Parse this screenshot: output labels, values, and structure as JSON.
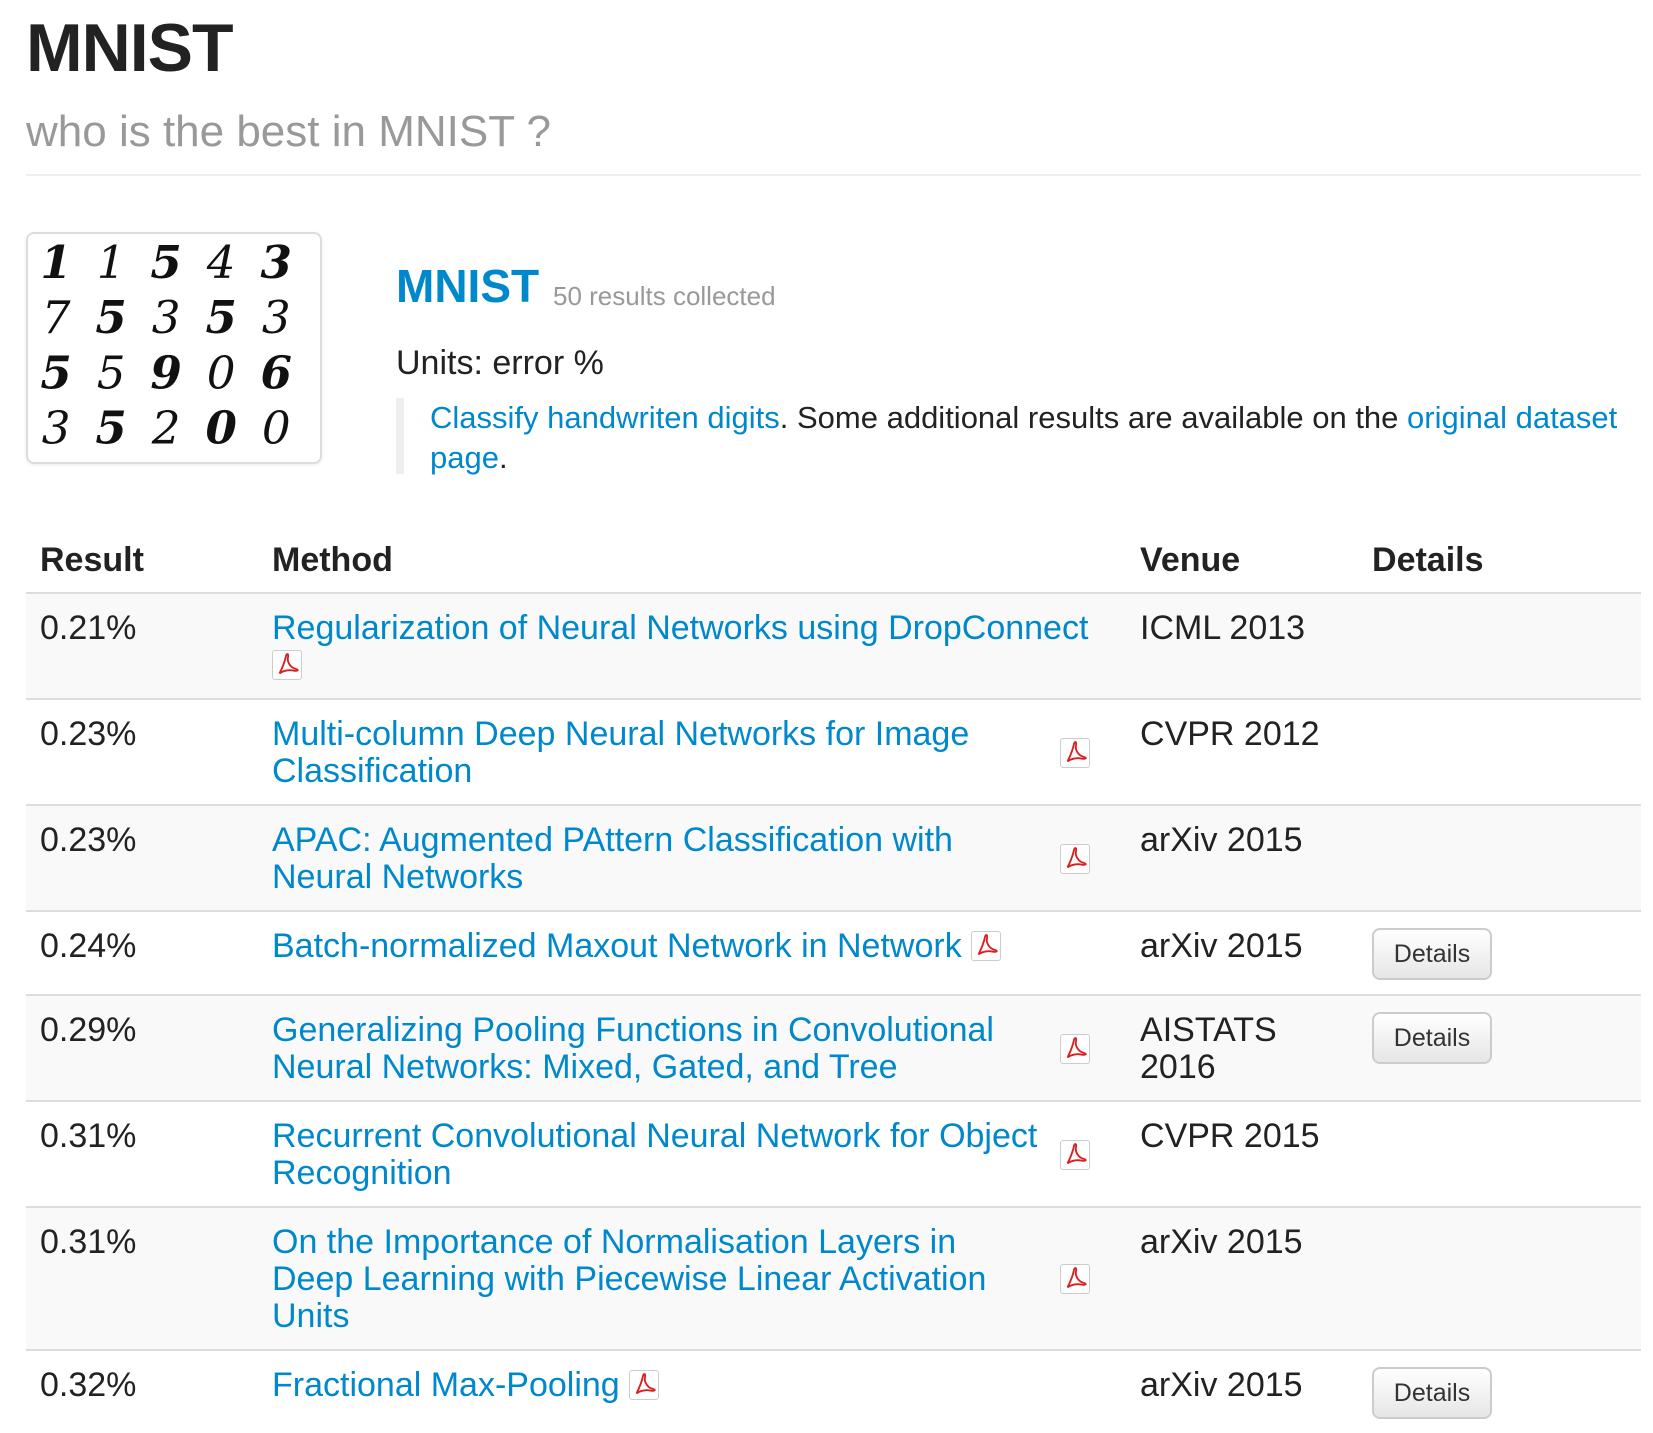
{
  "header": {
    "title": "MNIST",
    "subtitle": "who is the best in MNIST ?"
  },
  "dataset": {
    "name": "MNIST",
    "count_text": "50 results collected",
    "units": "Units: error %",
    "description": {
      "link1": "Classify handwriten digits",
      "text1": ". Some additional results are available on the ",
      "link2": "original dataset page",
      "text2": "."
    },
    "thumbnail_digits": [
      [
        "1",
        "1",
        "5",
        "4",
        "3"
      ],
      [
        "7",
        "5",
        "3",
        "5",
        "3"
      ],
      [
        "5",
        "5",
        "9",
        "0",
        "6"
      ],
      [
        "3",
        "5",
        "2",
        "0",
        "0"
      ]
    ]
  },
  "table": {
    "headers": {
      "result": "Result",
      "method": "Method",
      "venue": "Venue",
      "details": "Details"
    },
    "details_label": "Details",
    "pdf_icon": "pdf-icon",
    "rows": [
      {
        "result": "0.21%",
        "method": "Regularization of Neural Networks using DropConnect",
        "venue": "ICML 2013",
        "details": false
      },
      {
        "result": "0.23%",
        "method": "Multi-column Deep Neural Networks for Image Classification",
        "venue": "CVPR 2012",
        "details": false
      },
      {
        "result": "0.23%",
        "method": "APAC: Augmented PAttern Classification with Neural Networks",
        "venue": "arXiv 2015",
        "details": false
      },
      {
        "result": "0.24%",
        "method": "Batch-normalized Maxout Network in Network",
        "venue": "arXiv 2015",
        "details": true
      },
      {
        "result": "0.29%",
        "method": "Generalizing Pooling Functions in Convolutional Neural Networks: Mixed, Gated, and Tree",
        "venue": "AISTATS 2016",
        "details": true
      },
      {
        "result": "0.31%",
        "method": "Recurrent Convolutional Neural Network for Object Recognition",
        "venue": "CVPR 2015",
        "details": false
      },
      {
        "result": "0.31%",
        "method": "On the Importance of Normalisation Layers in Deep Learning with Piecewise Linear Activation Units",
        "venue": "arXiv 2015",
        "details": false
      },
      {
        "result": "0.32%",
        "method": "Fractional Max-Pooling",
        "venue": "arXiv 2015",
        "details": true
      }
    ]
  },
  "colors": {
    "link": "#0088cc",
    "muted": "#999999",
    "pdf_red": "#d9201f"
  }
}
